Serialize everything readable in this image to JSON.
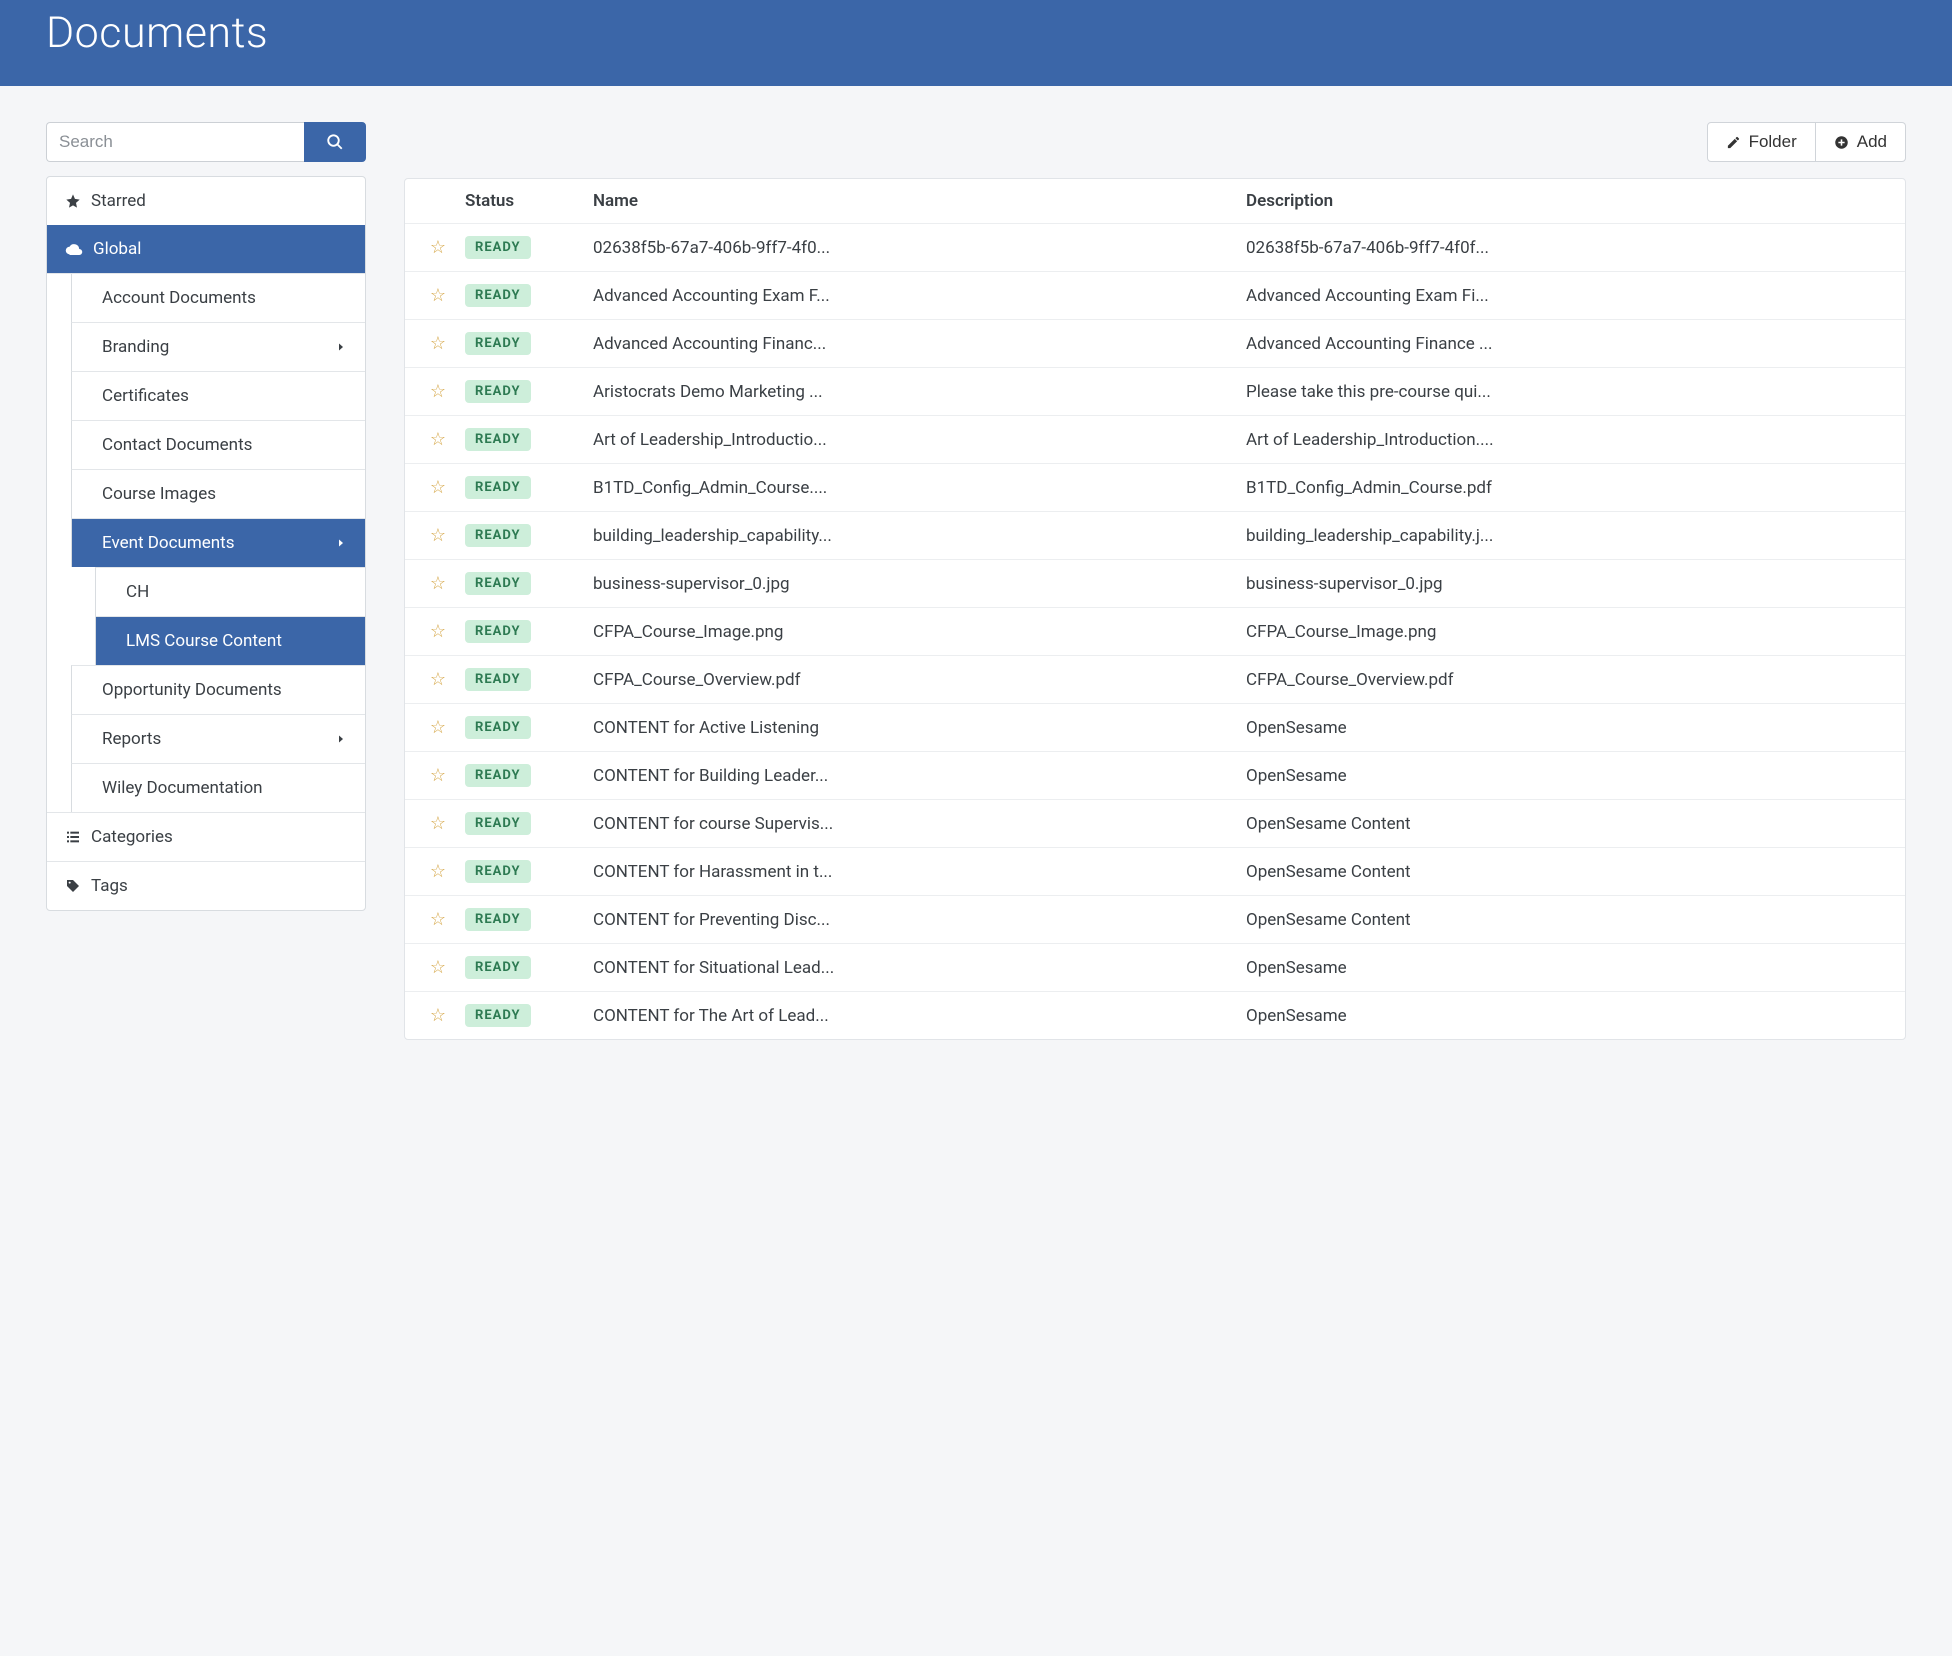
{
  "header": {
    "title": "Documents"
  },
  "search": {
    "placeholder": "Search"
  },
  "toolbar": {
    "folder_label": "Folder",
    "add_label": "Add"
  },
  "sidebar": {
    "starred_label": "Starred",
    "global_label": "Global",
    "categories_label": "Categories",
    "tags_label": "Tags",
    "global_items": [
      {
        "label": "Account Documents",
        "has_children": false,
        "active": false
      },
      {
        "label": "Branding",
        "has_children": true,
        "active": false
      },
      {
        "label": "Certificates",
        "has_children": false,
        "active": false
      },
      {
        "label": "Contact Documents",
        "has_children": false,
        "active": false
      },
      {
        "label": "Course Images",
        "has_children": false,
        "active": false
      },
      {
        "label": "Event Documents",
        "has_children": true,
        "active": true,
        "children": [
          {
            "label": "CH",
            "active": false
          },
          {
            "label": "LMS Course Content",
            "active": true
          }
        ]
      },
      {
        "label": "Opportunity Documents",
        "has_children": false,
        "active": false
      },
      {
        "label": "Reports",
        "has_children": true,
        "active": false
      },
      {
        "label": "Wiley Documentation",
        "has_children": false,
        "active": false
      }
    ]
  },
  "table": {
    "columns": {
      "status": "Status",
      "name": "Name",
      "description": "Description"
    },
    "status_badge": "READY",
    "rows": [
      {
        "name": "02638f5b-67a7-406b-9ff7-4f0...",
        "description": "02638f5b-67a7-406b-9ff7-4f0f..."
      },
      {
        "name": "Advanced Accounting Exam F...",
        "description": "Advanced Accounting Exam Fi..."
      },
      {
        "name": "Advanced Accounting Financ...",
        "description": "Advanced Accounting Finance ..."
      },
      {
        "name": "Aristocrats Demo Marketing ...",
        "description": "Please take this pre-course qui..."
      },
      {
        "name": "Art of Leadership_Introductio...",
        "description": "Art of Leadership_Introduction...."
      },
      {
        "name": "B1TD_Config_Admin_Course....",
        "description": "B1TD_Config_Admin_Course.pdf"
      },
      {
        "name": "building_leadership_capability...",
        "description": "building_leadership_capability.j..."
      },
      {
        "name": "business-supervisor_0.jpg",
        "description": "business-supervisor_0.jpg"
      },
      {
        "name": "CFPA_Course_Image.png",
        "description": "CFPA_Course_Image.png"
      },
      {
        "name": "CFPA_Course_Overview.pdf",
        "description": "CFPA_Course_Overview.pdf"
      },
      {
        "name": "CONTENT for Active Listening",
        "description": "OpenSesame"
      },
      {
        "name": "CONTENT for Building Leader...",
        "description": "OpenSesame"
      },
      {
        "name": "CONTENT for course Supervis...",
        "description": "OpenSesame Content"
      },
      {
        "name": "CONTENT for Harassment in t...",
        "description": "OpenSesame Content"
      },
      {
        "name": "CONTENT for Preventing Disc...",
        "description": "OpenSesame Content"
      },
      {
        "name": "CONTENT for Situational Lead...",
        "description": "OpenSesame"
      },
      {
        "name": "CONTENT for The Art of Lead...",
        "description": "OpenSesame"
      }
    ]
  }
}
